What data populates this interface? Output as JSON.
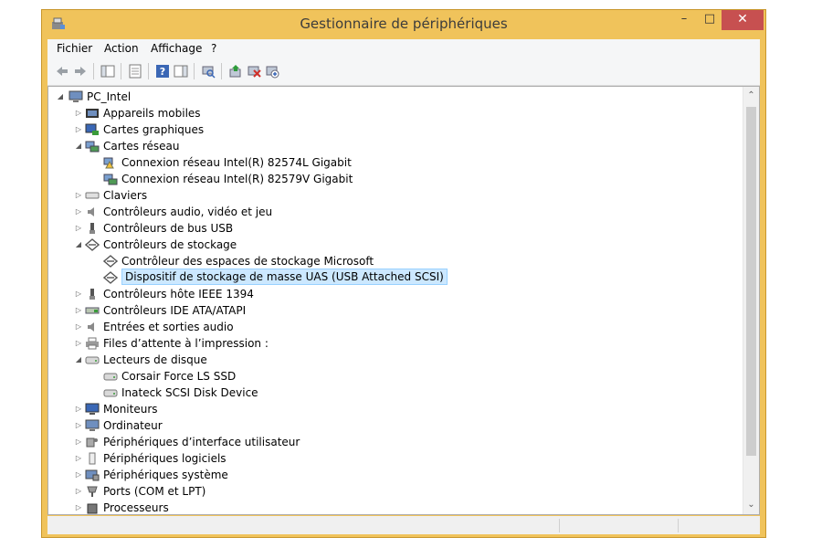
{
  "window": {
    "title": "Gestionnaire de périphériques"
  },
  "menubar": {
    "file": "Fichier",
    "action": "Action",
    "view": "Affichage",
    "help": "?"
  },
  "tree": {
    "root": {
      "label": "PC_Intel",
      "icon": "computer-icon"
    },
    "items": [
      {
        "label": "Appareils mobiles",
        "state": "collapsed",
        "icon": "mobile-device-icon",
        "level": 1
      },
      {
        "label": "Cartes graphiques",
        "state": "collapsed",
        "icon": "display-adapter-icon",
        "level": 1
      },
      {
        "label": "Cartes réseau",
        "state": "expanded",
        "icon": "network-adapter-icon",
        "level": 1
      },
      {
        "label": "Connexion réseau Intel(R) 82574L Gigabit",
        "state": "leaf",
        "icon": "network-adapter-warning-icon",
        "level": 2
      },
      {
        "label": "Connexion réseau Intel(R) 82579V Gigabit",
        "state": "leaf",
        "icon": "network-adapter-icon",
        "level": 2
      },
      {
        "label": "Claviers",
        "state": "collapsed",
        "icon": "keyboard-icon",
        "level": 1
      },
      {
        "label": "Contrôleurs audio, vidéo et jeu",
        "state": "collapsed",
        "icon": "speaker-icon",
        "level": 1
      },
      {
        "label": "Contrôleurs de bus USB",
        "state": "collapsed",
        "icon": "usb-icon",
        "level": 1
      },
      {
        "label": "Contrôleurs de stockage",
        "state": "expanded",
        "icon": "storage-controller-icon",
        "level": 1
      },
      {
        "label": "Contrôleur des espaces de stockage Microsoft",
        "state": "leaf",
        "icon": "storage-controller-icon",
        "level": 2
      },
      {
        "label": "Dispositif de stockage de masse UAS (USB Attached SCSI)",
        "state": "leaf",
        "icon": "storage-controller-icon",
        "level": 2,
        "selected": true
      },
      {
        "label": "Contrôleurs hôte IEEE 1394",
        "state": "collapsed",
        "icon": "firewire-icon",
        "level": 1
      },
      {
        "label": "Contrôleurs IDE ATA/ATAPI",
        "state": "collapsed",
        "icon": "ide-controller-icon",
        "level": 1
      },
      {
        "label": "Entrées et sorties audio",
        "state": "collapsed",
        "icon": "speaker-icon",
        "level": 1
      },
      {
        "label": "Files d’attente à l’impression :",
        "state": "collapsed",
        "icon": "printer-icon",
        "level": 1
      },
      {
        "label": "Lecteurs de disque",
        "state": "expanded",
        "icon": "disk-drive-icon",
        "level": 1
      },
      {
        "label": "Corsair Force LS SSD",
        "state": "leaf",
        "icon": "disk-drive-icon",
        "level": 2
      },
      {
        "label": "Inateck  SCSI Disk Device",
        "state": "leaf",
        "icon": "disk-drive-icon",
        "level": 2
      },
      {
        "label": "Moniteurs",
        "state": "collapsed",
        "icon": "monitor-icon",
        "level": 1
      },
      {
        "label": "Ordinateur",
        "state": "collapsed",
        "icon": "computer-icon",
        "level": 1
      },
      {
        "label": "Périphériques d’interface utilisateur",
        "state": "collapsed",
        "icon": "hid-icon",
        "level": 1
      },
      {
        "label": "Périphériques logiciels",
        "state": "collapsed",
        "icon": "software-device-icon",
        "level": 1
      },
      {
        "label": "Périphériques système",
        "state": "collapsed",
        "icon": "system-device-icon",
        "level": 1
      },
      {
        "label": "Ports (COM et LPT)",
        "state": "collapsed",
        "icon": "port-icon",
        "level": 1
      },
      {
        "label": "Processeurs",
        "state": "collapsed",
        "icon": "processor-icon",
        "level": 1
      }
    ]
  },
  "colors": {
    "frame": "#f0c35b",
    "close": "#c75050",
    "selection": "#cce8ff"
  }
}
